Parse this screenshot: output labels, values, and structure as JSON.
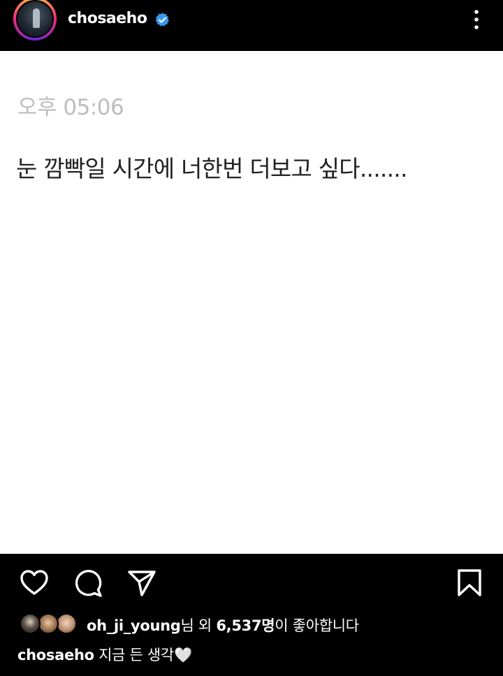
{
  "header": {
    "username": "chosaeho",
    "verified": true,
    "more_icon": "more-vertical-icon"
  },
  "post": {
    "time": "오후 05:06",
    "message": "눈 깜빡일 시간에 너한번 더보고 싶다......."
  },
  "actions": {
    "like_icon": "heart-icon",
    "comment_icon": "comment-icon",
    "share_icon": "send-icon",
    "save_icon": "bookmark-icon"
  },
  "likes": {
    "first_liker": "oh_ji_young",
    "suffix_1": "님 외 ",
    "count": "6,537명",
    "suffix_2": "이 좋아합니다"
  },
  "caption": {
    "username": "chosaeho",
    "text": " 지금 든 생각🤍"
  },
  "colors": {
    "verified_blue": "#3897f0",
    "background_dark": "#000000",
    "post_background": "#ffffff",
    "time_gray": "#bdbdbd"
  }
}
